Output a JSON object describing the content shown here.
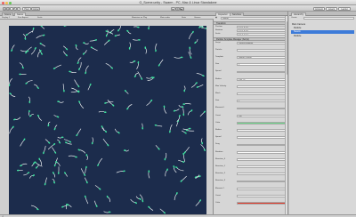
{
  "window": {
    "title": "G_Scene.unity - Swarm - PC, Mac & Linux Standalone"
  },
  "toolbar": {
    "buttons": [
      "✥",
      "✥",
      "↔",
      "↻",
      "▢"
    ],
    "pivot_label": "Pivot",
    "global_label": "Global",
    "play_label": "▶",
    "pause_label": "❚❚",
    "step_label": "▶❚",
    "account_label": "Account",
    "layers_label": "Layers",
    "layout_label": "Layout"
  },
  "game_panel": {
    "tabs": [
      "Scene",
      "Game"
    ],
    "display_label": "Display 1",
    "aspect_label": "Free Aspect",
    "scale_label": "Scale",
    "maximize_label": "Maximize on Play",
    "mute_label": "Mute audio",
    "stats_label": "Stats",
    "gizmos_label": "Gizmos"
  },
  "inspector": {
    "tabs": [
      "Inspector",
      "Services"
    ],
    "header_name": "Swarm",
    "transform_label": "Transform",
    "transform_rows": [
      {
        "label": "Position",
        "value": "X 0  Y 0  Z 0"
      },
      {
        "label": "Rotation",
        "value": "X 0  Y 0  Z 0"
      },
      {
        "label": "Scale",
        "value": "X 1  Y 1  Z 1"
      }
    ],
    "component_label": "Particle Template Manager (Script)",
    "rows": [
      {
        "label": "Script",
        "value": "ParticleTemplate"
      },
      {
        "label": "Particle",
        "value": ""
      },
      {
        "label": "Template",
        "value": "Swarm Particle"
      },
      {
        "label": "Size",
        "value": "2"
      },
      {
        "label": "Speed",
        "value": ""
      },
      {
        "label": "Radius",
        "value": "0.05 75"
      },
      {
        "label": "Max Velocity",
        "value": ""
      },
      {
        "label": "Mesh",
        "value": ""
      },
      {
        "label": "Size",
        "value": "2"
      },
      {
        "label": "Element 0",
        "value": ""
      },
      {
        "label": "Count",
        "value": "200"
      },
      {
        "label": "Color",
        "value": ""
      },
      {
        "label": "Radius",
        "value": ""
      },
      {
        "label": "Speed",
        "value": ""
      },
      {
        "label": "Drag",
        "value": ""
      },
      {
        "label": "Random",
        "value": ""
      },
      {
        "label": "Reaction_0",
        "value": ""
      },
      {
        "label": "Reaction_1",
        "value": ""
      },
      {
        "label": "Reaction_2",
        "value": ""
      },
      {
        "label": "Reaction_3",
        "value": ""
      },
      {
        "label": "Element 1",
        "value": ""
      },
      {
        "label": "Count",
        "value": ""
      },
      {
        "label": "Color",
        "value": ""
      }
    ]
  },
  "hierarchy": {
    "title": "Hierarchy",
    "create_label": "Create",
    "items": [
      {
        "label": "Main Camera",
        "selected": false
      },
      {
        "label": "Particle",
        "selected": false
      },
      {
        "label": "Swarm",
        "selected": true
      },
      {
        "label": "Particle",
        "selected": false
      }
    ]
  },
  "colors": {
    "viewport_bg": "#1c2c4c",
    "selection": "#3d7bd9",
    "particle_body": "#e8ecef",
    "particle_glow": "#3fe3a0"
  }
}
